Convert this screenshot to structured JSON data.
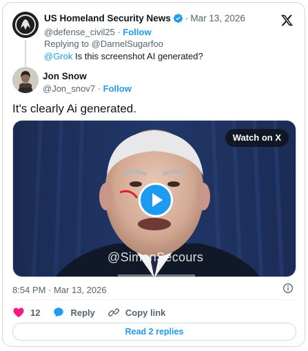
{
  "parent_tweet": {
    "author_name": "US Homeland Security News",
    "verified": true,
    "date": "Mar 13, 2026",
    "handle": "@defense_civil25",
    "follow_label": "Follow",
    "separator": "·",
    "replying_to_prefix": "Replying to ",
    "replying_to_handle": "@DarnelSugarfoo",
    "mention": "@Grok",
    "text": "Is this screenshot AI generated?"
  },
  "main_tweet": {
    "author_name": "Jon Snow",
    "handle": "@Jon_snov7",
    "follow_label": "Follow",
    "separator": "·",
    "text": "It's clearly Ai generated.",
    "media": {
      "watch_label": "Watch on X",
      "watermark": "@SimonSecours"
    },
    "timestamp": "8:54 PM · Mar 13, 2026",
    "likes_count": "12",
    "reply_label": "Reply",
    "copy_link_label": "Copy link",
    "read_replies_label": "Read 2 replies"
  },
  "colors": {
    "accent": "#1d9bf0",
    "like": "#f91880",
    "text": "#0f1419",
    "muted": "#536471",
    "border": "#cfd9de"
  },
  "icons": [
    "x-logo-icon",
    "verified-badge-icon",
    "play-icon",
    "info-icon",
    "heart-icon",
    "reply-bubble-icon",
    "link-icon"
  ]
}
